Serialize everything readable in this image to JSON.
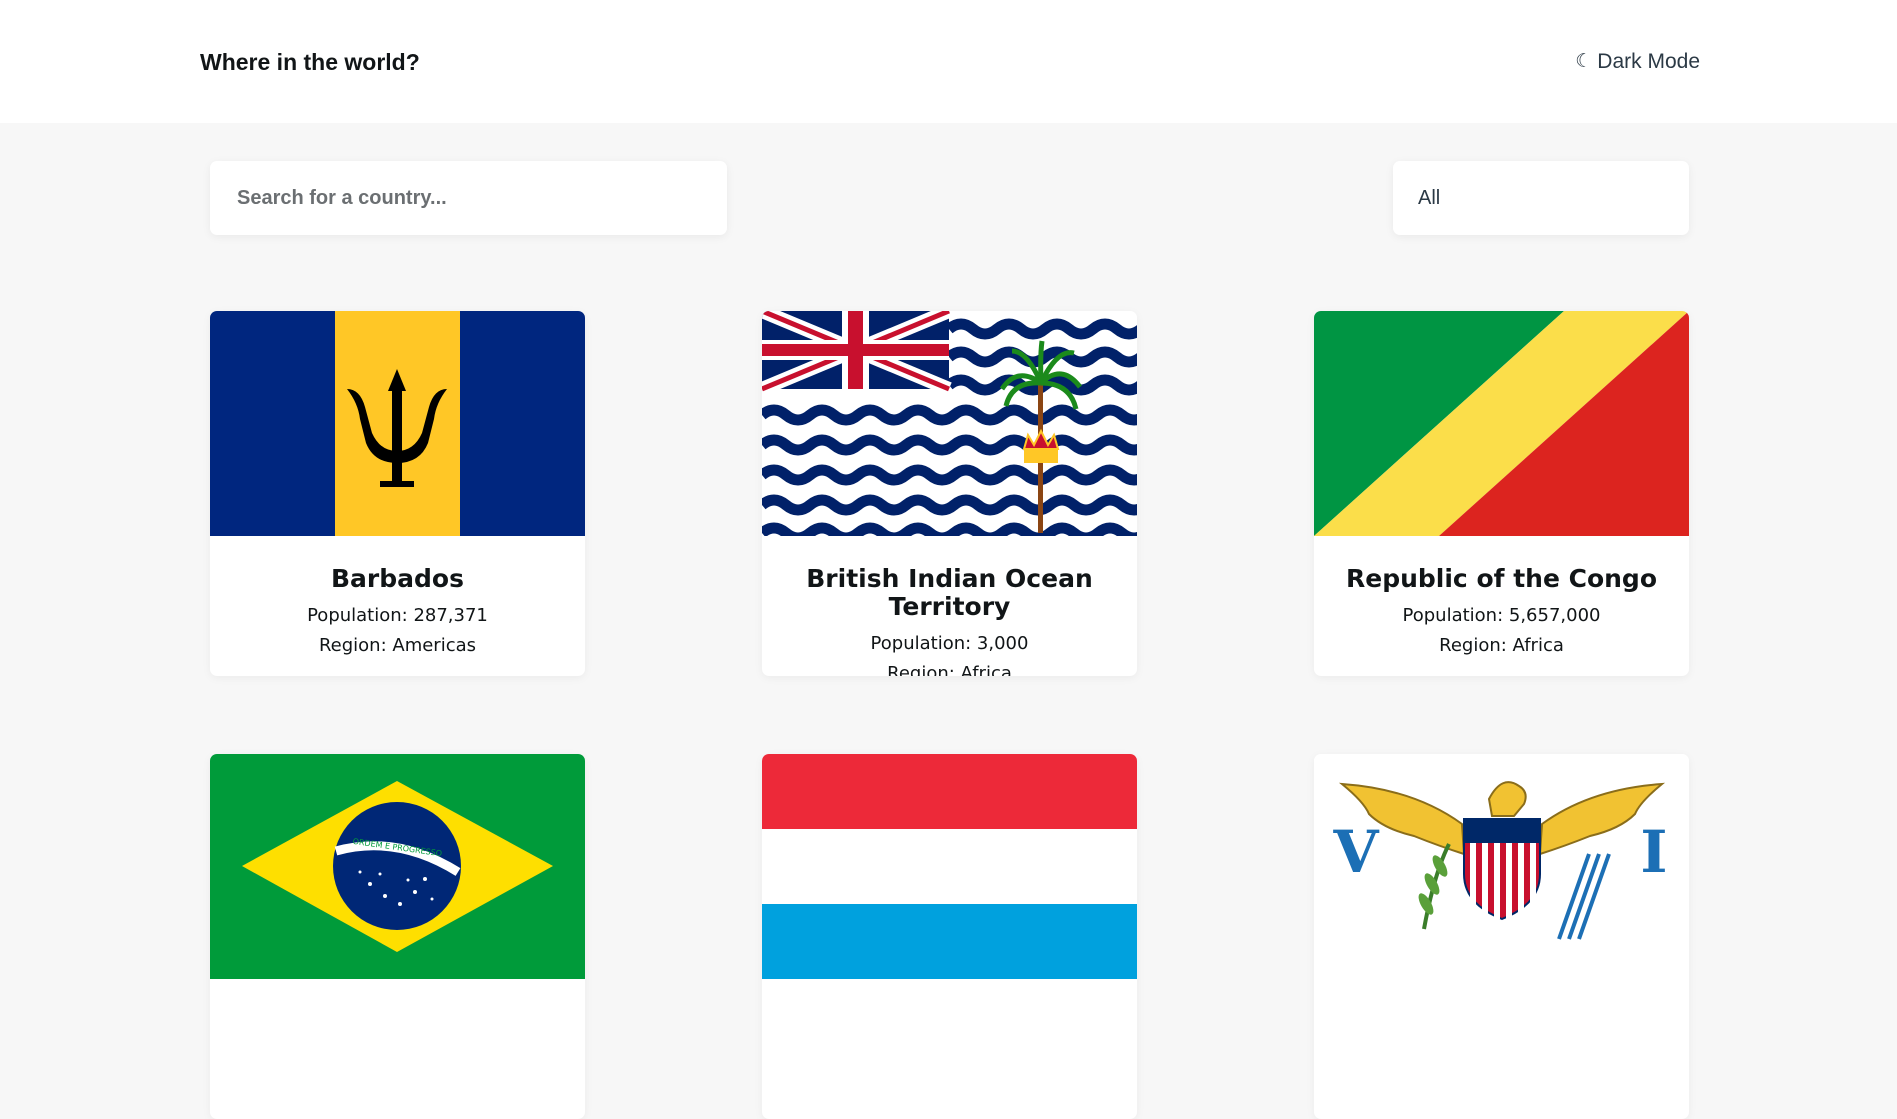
{
  "header": {
    "title": "Where in the world?",
    "dark_mode_label": "Dark Mode",
    "moon_glyph": "☾"
  },
  "search": {
    "placeholder": "Search for a country...",
    "value": ""
  },
  "filter": {
    "selected": "All"
  },
  "labels": {
    "population": "Population: ",
    "region": "Region: "
  },
  "countries": [
    {
      "name": "Barbados",
      "population": "287,371",
      "region": "Americas",
      "flag_icon": "barbados-flag"
    },
    {
      "name": "British Indian Ocean Territory",
      "population": "3,000",
      "region": "Africa",
      "flag_icon": "biot-flag"
    },
    {
      "name": "Republic of the Congo",
      "population": "5,657,000",
      "region": "Africa",
      "flag_icon": "congo-flag"
    },
    {
      "name": "",
      "population": "",
      "region": "",
      "flag_icon": "brazil-flag"
    },
    {
      "name": "",
      "population": "",
      "region": "",
      "flag_icon": "luxembourg-flag"
    },
    {
      "name": "",
      "population": "",
      "region": "",
      "flag_icon": "us-virgin-islands-flag"
    }
  ],
  "flag_text": {
    "brazil_motto": "ORDEM E PROGRESSO",
    "vi_left": "V",
    "vi_right": "I"
  },
  "colors": {
    "background": "#f7f7f7",
    "surface": "#ffffff",
    "text": "#111517"
  }
}
